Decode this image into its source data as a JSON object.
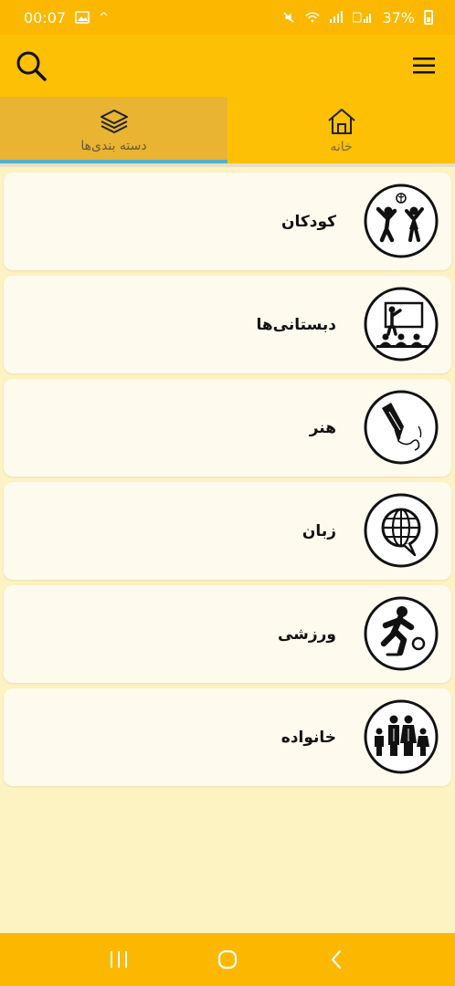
{
  "status_bar": {
    "time": "00:07",
    "carrier_mark": "^",
    "battery_text": "37%"
  },
  "app_bar": {
    "search_icon": "search-icon",
    "menu_icon": "hamburger-menu-icon"
  },
  "tabs": [
    {
      "label": "دسته بندی‌ها",
      "icon": "layers-icon",
      "selected": true
    },
    {
      "label": "خانه",
      "icon": "home-icon",
      "selected": false
    }
  ],
  "categories": [
    {
      "label": "کودکان",
      "icon": "children-playing-icon"
    },
    {
      "label": "دبستانی‌ها",
      "icon": "classroom-teacher-icon"
    },
    {
      "label": "هنر",
      "icon": "fountain-pen-icon"
    },
    {
      "label": "زبان",
      "icon": "globe-speech-icon"
    },
    {
      "label": "ورزشی",
      "icon": "soccer-player-icon"
    },
    {
      "label": "خانواده",
      "icon": "family-icon"
    }
  ],
  "colors": {
    "header": "#fec004",
    "status_bar": "#fcb800",
    "selected_tab": "#e8b432",
    "tab_indicator": "#54b1c9",
    "background": "#fdf2c2",
    "card": "#fefaee"
  }
}
